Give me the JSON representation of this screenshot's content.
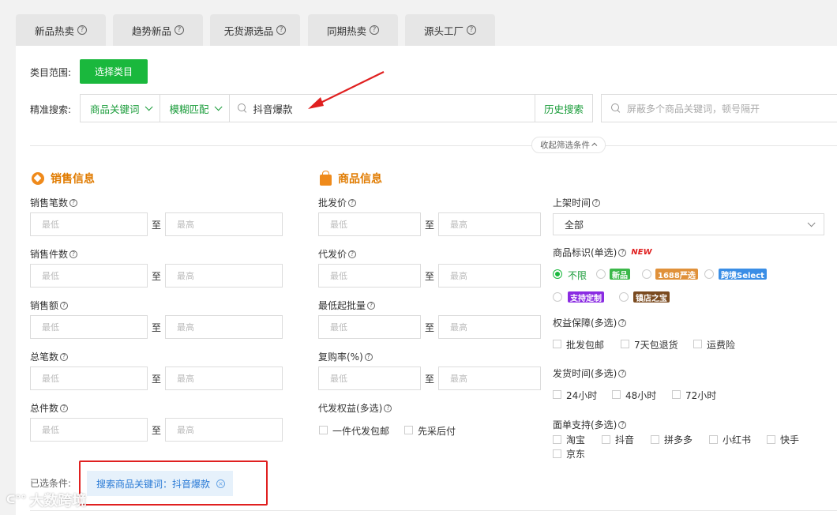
{
  "tabs": [
    "新品热卖",
    "趋势新品",
    "无货源选品",
    "同期热卖",
    "源头工厂"
  ],
  "category": {
    "label": "类目范围:",
    "button": "选择类目"
  },
  "search": {
    "label": "精准搜索:",
    "keyword_type": "商品关键词",
    "match_type": "模糊匹配",
    "value": "抖音爆款",
    "history_button": "历史搜索",
    "exclude_placeholder": "屏蔽多个商品关键词，顿号隔开"
  },
  "collapse_label": "收起筛选条件",
  "sales": {
    "title": "销售信息",
    "fields": [
      "销售笔数",
      "销售件数",
      "销售额",
      "总笔数",
      "总件数"
    ]
  },
  "product": {
    "title": "商品信息",
    "fields": [
      "批发价",
      "代发价",
      "最低起批量",
      "复购率(%)"
    ],
    "dropship_rights": {
      "label": "代发权益(多选)",
      "options": [
        "一件代发包邮",
        "先采后付"
      ]
    }
  },
  "range": {
    "min_placeholder": "最低",
    "max_placeholder": "最高",
    "to": "至"
  },
  "listing_time": {
    "label": "上架时间",
    "value": "全部"
  },
  "product_tag": {
    "label": "商品标识(单选)",
    "new_badge": "NEW",
    "options": [
      {
        "label": "不限",
        "selected": true
      },
      {
        "label": "新品",
        "color": "#3cb84a"
      },
      {
        "label": "1688严选",
        "color": "#e0913a"
      },
      {
        "label": "跨境Select",
        "color": "#3a8ee6"
      },
      {
        "label": "支持定制",
        "color": "#8a2be2"
      },
      {
        "label": "镇店之宝",
        "color": "#7a4a1f"
      }
    ]
  },
  "guarantee": {
    "label": "权益保障(多选)",
    "options": [
      "批发包邮",
      "7天包退货",
      "运费险"
    ]
  },
  "ship_time": {
    "label": "发货时间(多选)",
    "options": [
      "24小时",
      "48小时",
      "72小时"
    ]
  },
  "waybill": {
    "label": "面单支持(多选)",
    "options": [
      "淘宝",
      "抖音",
      "拼多多",
      "小红书",
      "快手",
      "京东"
    ]
  },
  "selected": {
    "label": "已选条件:",
    "chip": "搜索商品关键词：抖音爆款"
  },
  "watermark": "大数跨境"
}
